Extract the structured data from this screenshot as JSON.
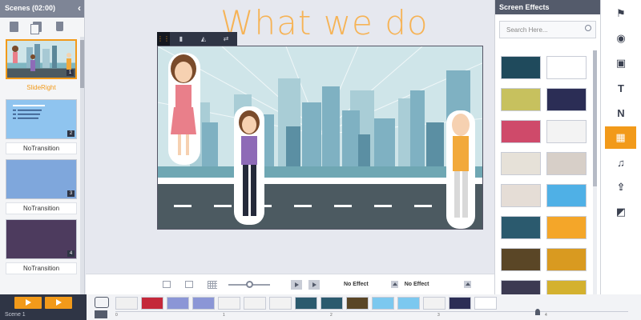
{
  "scenes_panel": {
    "title": "Scenes (02:00)",
    "scenes": [
      {
        "number": "1",
        "transition": "SlideRight",
        "active": true
      },
      {
        "number": "2",
        "transition": "NoTransition",
        "active": false
      },
      {
        "number": "3",
        "transition": "NoTransition",
        "active": false
      },
      {
        "number": "4",
        "transition": "NoTransition",
        "active": false
      }
    ]
  },
  "stage": {
    "title_text": "What we do"
  },
  "bottom_bar": {
    "effect_in_label": "No Effect",
    "effect_out_label": "No Effect"
  },
  "effects_panel": {
    "title": "Screen Effects",
    "search_placeholder": "Search Here...",
    "effect_colors": [
      "#1f4a5c",
      "#ffffff",
      "#c7c15e",
      "#2b2d55",
      "#cf4a6a",
      "#f3f3f3",
      "#e6e1d8",
      "#d7cfc8",
      "#e5ddd6",
      "#4fb0e6",
      "#2b5a6e",
      "#f4a629",
      "#5a4626",
      "#d99a20",
      "#3c3a52",
      "#d4b12f"
    ]
  },
  "right_tools": {
    "items": [
      {
        "name": "character-icon",
        "glyph": "⚑"
      },
      {
        "name": "location-pin-icon",
        "glyph": "◉"
      },
      {
        "name": "image-icon",
        "glyph": "▣"
      },
      {
        "name": "text-icon",
        "glyph": "T"
      },
      {
        "name": "n-icon",
        "glyph": "N"
      },
      {
        "name": "screen-effects-icon",
        "glyph": "▦"
      },
      {
        "name": "music-icon",
        "glyph": "♫"
      },
      {
        "name": "upload-icon",
        "glyph": "⇪"
      },
      {
        "name": "background-icon",
        "glyph": "◩"
      }
    ]
  },
  "timeline": {
    "scene_label": "Scene 1",
    "ruler_ticks": [
      "0",
      "1",
      "2",
      "3",
      "4"
    ],
    "item_colors": [
      "#f0f0f0",
      "#c4283a",
      "#8b96d6",
      "#8b96d6",
      "#f2f2f2",
      "#f2f2f2",
      "#f2f2f2",
      "#2b5a6e",
      "#2b5a6e",
      "#5a4626",
      "#7cc8ef",
      "#7cc8ef",
      "#f2f2f2",
      "#2b2d55",
      "#ffffff"
    ]
  }
}
